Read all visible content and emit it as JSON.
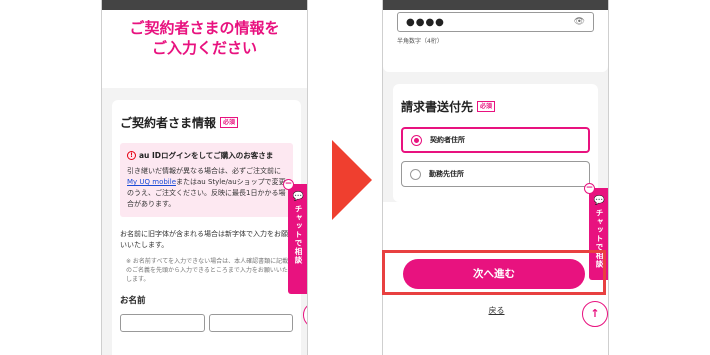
{
  "left": {
    "hero_title": "ご契約者さまの情報を\nご入力ください",
    "section_title": "ご契約者さま情報",
    "required_badge": "必須",
    "info_head": "au IDログインをしてご購入のお客さま",
    "info_body_1": "引き継いだ情報が異なる場合は、必ずご注文前に",
    "info_link": "My UQ mobile",
    "info_body_2": "またはau Style/auショップで変更のうえ、ご注文ください。反映に最長1日かかる場合があります。",
    "note": "お名前に旧字体が含まれる場合は新字体で入力をお願いいたします。",
    "note_small": "※ お名前すべてを入力できない場合は、本人確認書類に記載のご名義を先頭から入力できるところまで入力をお願いいたします。",
    "name_label": "お名前"
  },
  "chat": {
    "label": "チャットで相談",
    "minus": "−",
    "bubble": "💬"
  },
  "scroll_top": "↑",
  "right": {
    "password_dots": "●●●●",
    "eye_icon": "👁",
    "password_hint": "半角数字（4桁）",
    "billing_title": "請求書送付先",
    "required_badge": "必須",
    "options": [
      "契約者住所",
      "勤務先住所"
    ],
    "next_button": "次へ進む",
    "back_link": "戻る"
  },
  "colors": {
    "accent": "#e8127f",
    "arrow": "#ef3f2f",
    "highlight": "#e84040"
  }
}
